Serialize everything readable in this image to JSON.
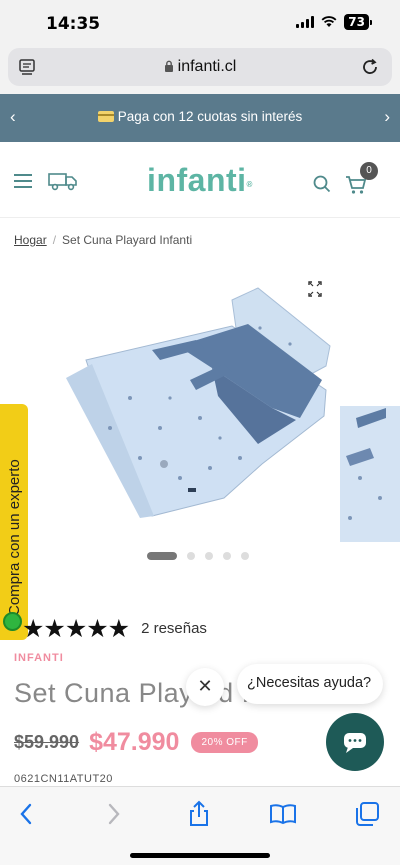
{
  "status_bar": {
    "time": "14:35",
    "battery": "73"
  },
  "browser": {
    "url": "infanti.cl"
  },
  "promo": {
    "text": "Paga con 12 cuotas sin interés"
  },
  "header": {
    "logo": "infanti",
    "cart_count": "0"
  },
  "breadcrumb": {
    "home": "Hogar",
    "current": "Set Cuna Playard Infanti"
  },
  "expert_tab": {
    "label": "Compra con un experto"
  },
  "product": {
    "rating_stars": "★★★★★",
    "rating_value": 5,
    "reviews": "2 reseñas",
    "brand": "INFANTI",
    "title": "Set Cuna Playard Infanti",
    "old_price": "$59.990",
    "new_price": "$47.990",
    "discount": "20% OFF",
    "sku": "0621CN11ATUT20"
  },
  "chat": {
    "prompt": "¿Necesitas ayuda?"
  },
  "colors": {
    "promo_bg": "#5a7a8c",
    "brand_teal": "#5db5a4",
    "price_pink": "#f08c9f",
    "chat_fab": "#1e5a57",
    "expert_yellow": "#f2cd17"
  },
  "icons": [
    "menu-icon",
    "truck-icon",
    "search-icon",
    "cart-icon",
    "expand-icon",
    "chat-icon",
    "back-icon",
    "forward-icon",
    "share-icon",
    "bookmarks-icon",
    "tabs-icon",
    "reload-icon",
    "lock-icon"
  ]
}
